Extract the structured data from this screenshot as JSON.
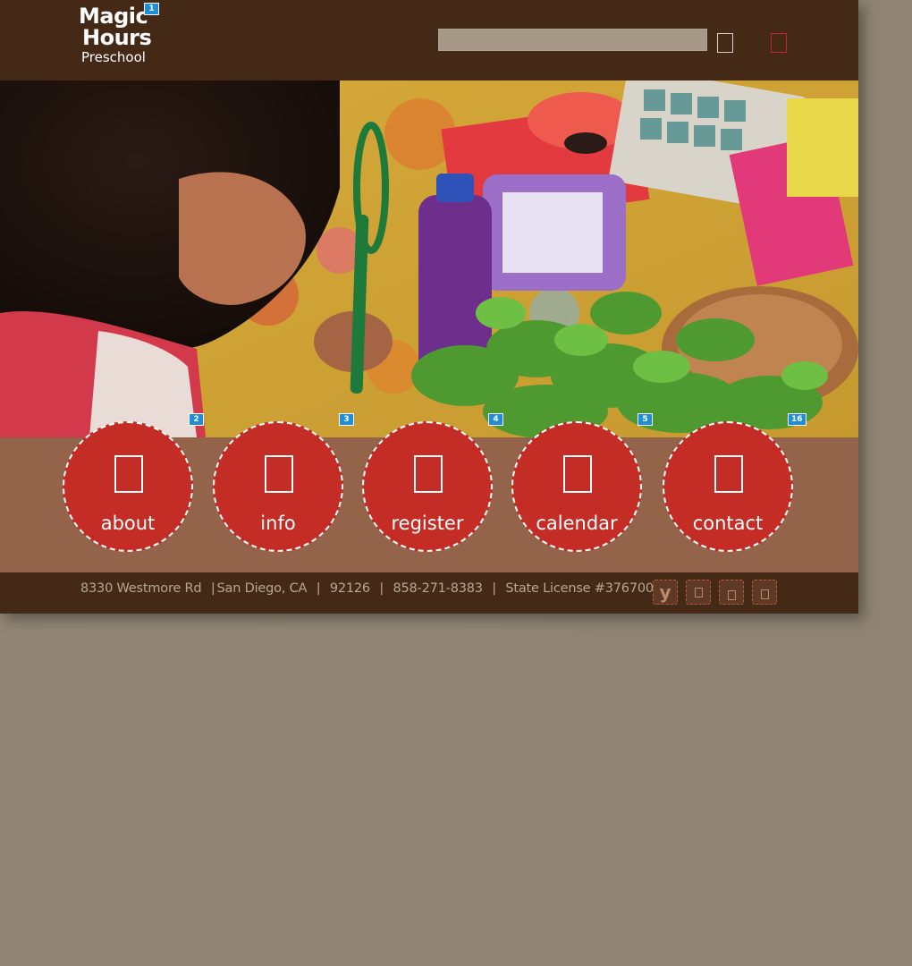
{
  "logo": {
    "line1": "Magic",
    "line2": "Hours",
    "line3": "Preschool"
  },
  "header": {
    "search_placeholder": "",
    "search_value": ""
  },
  "badges": {
    "logo": "1",
    "about": "2",
    "info": "3",
    "register": "4",
    "calendar": "5",
    "contact": "16"
  },
  "nav": [
    {
      "label": "about",
      "icon": "about-icon"
    },
    {
      "label": "info",
      "icon": "info-icon"
    },
    {
      "label": "register",
      "icon": "register-icon"
    },
    {
      "label": "calendar",
      "icon": "calendar-icon"
    },
    {
      "label": "contact",
      "icon": "contact-icon"
    }
  ],
  "footer": {
    "street": "8330 Westmore Rd",
    "city": "San Diego, CA",
    "zip": "92126",
    "phone": "858-271-8383",
    "license": "State License #376700608",
    "sep": "|",
    "social": [
      {
        "name": "yelp",
        "glyph": "y"
      },
      {
        "name": "social-2",
        "glyph": ""
      },
      {
        "name": "social-3",
        "glyph": ""
      },
      {
        "name": "social-4",
        "glyph": ""
      }
    ]
  },
  "colors": {
    "header_bg": "#432916",
    "nav_band": "#94644a",
    "circle": "#c42c26",
    "page_bg": "#8f8474",
    "badge": "#1e8fd6"
  }
}
